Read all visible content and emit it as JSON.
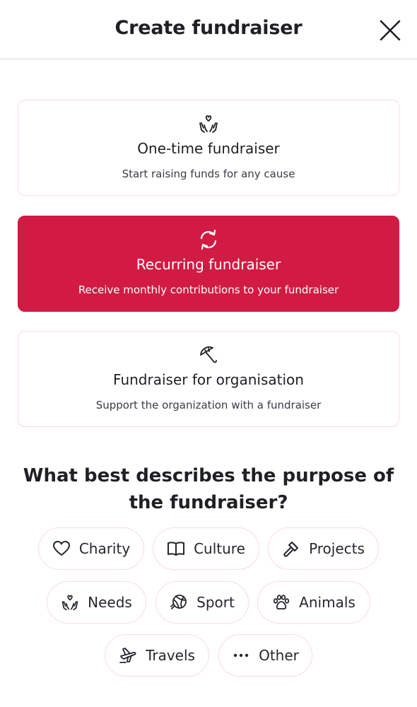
{
  "header": {
    "title": "Create fundraiser",
    "close_icon": "close-icon"
  },
  "options": [
    {
      "title": "One-time fundraiser",
      "subtitle": "Start raising funds for any cause",
      "icon": "hands-heart-icon",
      "selected": false
    },
    {
      "title": "Recurring fundraiser",
      "subtitle": "Receive monthly contributions to your fundraiser",
      "icon": "recurring-icon",
      "selected": true
    },
    {
      "title": "Fundraiser for organisation",
      "subtitle": "Support the organization with a fundraiser",
      "icon": "umbrella-icon",
      "selected": false
    }
  ],
  "purpose": {
    "question": "What best describes the purpose of the fundraiser?",
    "chips": [
      {
        "label": "Charity",
        "icon": "heart-icon"
      },
      {
        "label": "Culture",
        "icon": "book-icon"
      },
      {
        "label": "Projects",
        "icon": "hammer-icon"
      },
      {
        "label": "Needs",
        "icon": "hands-heart-icon"
      },
      {
        "label": "Sport",
        "icon": "ball-icon"
      },
      {
        "label": "Animals",
        "icon": "paw-icon"
      },
      {
        "label": "Travels",
        "icon": "plane-icon"
      },
      {
        "label": "Other",
        "icon": "dots-icon"
      }
    ]
  },
  "colors": {
    "accent": "#d21b42",
    "card_border": "#f6dde2",
    "text": "#1f1f24"
  }
}
